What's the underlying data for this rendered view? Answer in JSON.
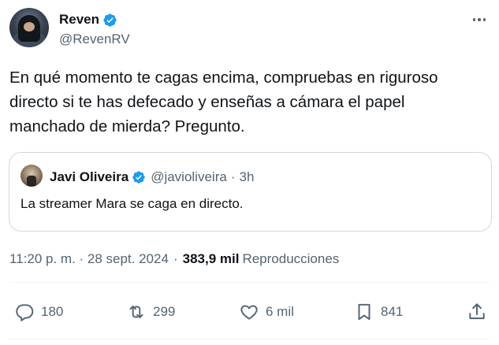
{
  "tweet": {
    "author": {
      "display_name": "Reven",
      "handle": "@RevenRV",
      "verified": true
    },
    "text": "En qué momento te cagas encima, compruebas en riguroso directo si te has defecado y enseñas a cámara el papel manchado de mierda? Pregunto.",
    "quoted": {
      "display_name": "Javi Oliveira",
      "handle": "@javioliveira",
      "separator": "·",
      "time": "3h",
      "text": "La streamer Mara se caga en directo."
    },
    "meta": {
      "timestamp": "11:20 p. m. · 28 sept. 2024",
      "separator": "·",
      "views": "383,9 mil",
      "views_label": "Reproducciones"
    },
    "actions": {
      "replies": "180",
      "reposts": "299",
      "likes": "6 mil",
      "bookmarks": "841"
    }
  },
  "icons": {
    "more": "more-horizontal-icon",
    "verified": "verified-badge-icon",
    "reply": "reply-icon",
    "repost": "repost-icon",
    "like": "heart-icon",
    "bookmark": "bookmark-icon",
    "share": "share-icon"
  },
  "colors": {
    "verified_blue": "#1d9bf0",
    "text_primary": "#0f1419",
    "text_secondary": "#536471",
    "border": "#cfd9de"
  }
}
